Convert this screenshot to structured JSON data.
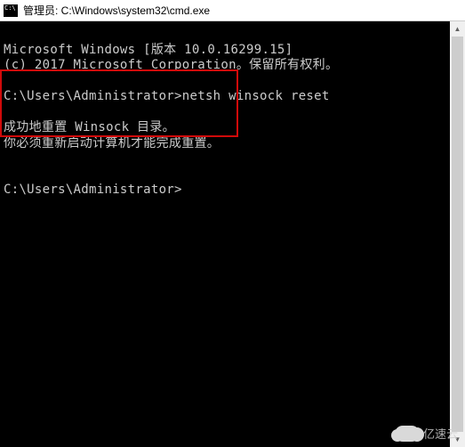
{
  "title_bar": {
    "text": "管理员: C:\\Windows\\system32\\cmd.exe"
  },
  "terminal": {
    "line1": "Microsoft Windows [版本 10.0.16299.15]",
    "line2": "(c) 2017 Microsoft Corporation。保留所有权利。",
    "blank": "",
    "prompt1_path": "C:\\Users\\Administrator>",
    "prompt1_cmd": "netsh winsock reset",
    "result1": "成功地重置 Winsock 目录。",
    "result2": "你必须重新启动计算机才能完成重置。",
    "prompt2_path": "C:\\Users\\Administrator>"
  },
  "scrollbar": {
    "up": "▲",
    "down": "▼"
  },
  "watermark": {
    "text": "亿速云"
  }
}
